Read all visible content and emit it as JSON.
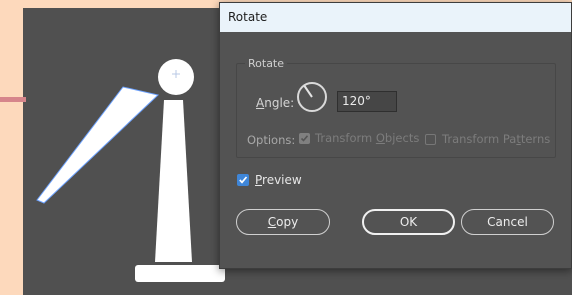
{
  "dialog": {
    "title": "Rotate",
    "group_label": "Rotate",
    "angle": {
      "label_first": "A",
      "label_rest": "ngle:",
      "value": "120°"
    },
    "options": {
      "label": "Options:",
      "transform_objects": {
        "label_pre": "Transform ",
        "label_ul": "O",
        "label_post": "bjects",
        "checked": true,
        "enabled": false
      },
      "transform_patterns": {
        "label_pre": "Transform Pa",
        "label_ul": "t",
        "label_post": "terns",
        "checked": false,
        "enabled": false
      }
    },
    "preview": {
      "label_first": "P",
      "label_rest": "review",
      "checked": true
    },
    "buttons": {
      "copy_first": "C",
      "copy_rest": "opy",
      "ok": "OK",
      "cancel": "Cancel"
    }
  },
  "colors": {
    "canvas": "#505050",
    "page_background": "#fdd9bc",
    "dialog_titlebar": "#eaf3fa",
    "checkbox_accent": "#3f86d8",
    "selection_outline": "#6ea3ff"
  },
  "icons": {
    "angle_dial": "rotation-dial-icon",
    "checkmark": "checkmark-icon"
  }
}
